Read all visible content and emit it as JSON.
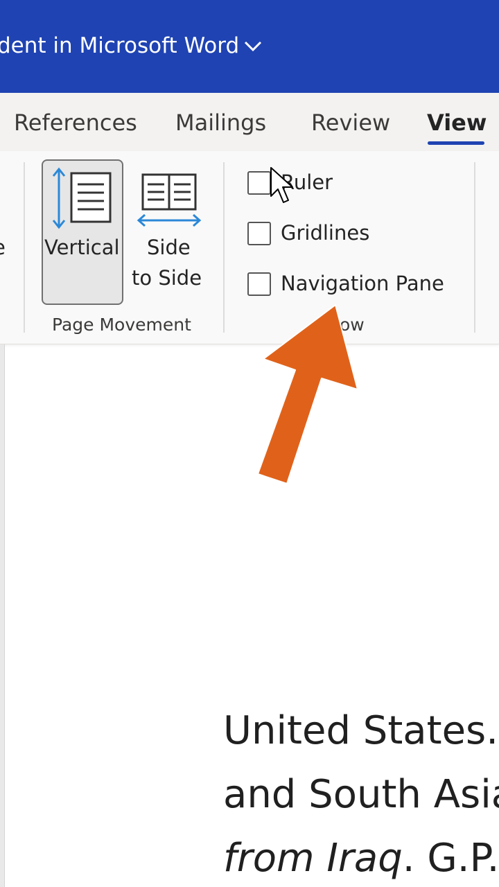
{
  "titlebar": {
    "title": "dent in Microsoft Word"
  },
  "tabs": [
    {
      "label": "References"
    },
    {
      "label": "Mailings"
    },
    {
      "label": "Review"
    },
    {
      "label": "View"
    }
  ],
  "ribbon": {
    "page_movement": {
      "partial_label": "e",
      "vertical_label": "Vertical",
      "side_label_1": "Side",
      "side_label_2": "to Side",
      "group_label": "Page Movement"
    },
    "show": {
      "ruler_label": "Ruler",
      "gridlines_label": "Gridlines",
      "navpane_label": "Navigation Pane",
      "group_label_partial": "ow"
    }
  },
  "document": {
    "line1": "United States.",
    "line2": "and South Asia",
    "line3_italic": "from Iraq",
    "line3_rest": ". G.P."
  },
  "colors": {
    "titlebar": "#1f43b2",
    "arrow": "#e0621a",
    "blue_icon": "#2b88d8"
  }
}
